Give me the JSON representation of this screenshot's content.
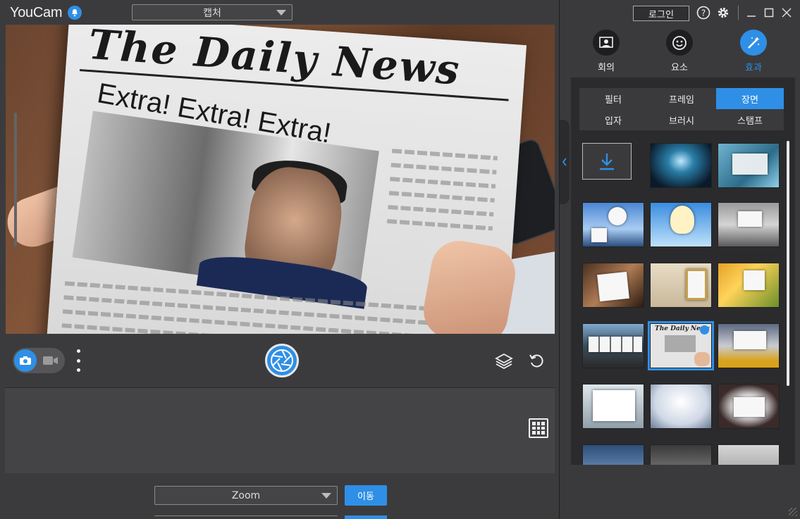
{
  "app": {
    "name": "YouCam",
    "mode_select": "캡처",
    "login_label": "로그인"
  },
  "preview": {
    "masthead": "The Daily News",
    "headline": "Extra! Extra! Extra!"
  },
  "controls": {
    "camera_mode": "photo"
  },
  "bottom": {
    "zoom_select": "Zoom",
    "go_label": "이동"
  },
  "main_tabs": [
    {
      "label": "회의",
      "icon": "meeting-icon"
    },
    {
      "label": "요소",
      "icon": "emoji-icon"
    },
    {
      "label": "효과",
      "icon": "magic-wand-icon",
      "active": true
    }
  ],
  "effect_categories": [
    {
      "label": "필터"
    },
    {
      "label": "프레임"
    },
    {
      "label": "장면",
      "active": true
    },
    {
      "label": "입자"
    },
    {
      "label": "브러시"
    },
    {
      "label": "스탬프"
    }
  ],
  "colors": {
    "accent": "#2f8fe6",
    "background": "#3b3b3d",
    "panel": "#2b2b2d"
  }
}
